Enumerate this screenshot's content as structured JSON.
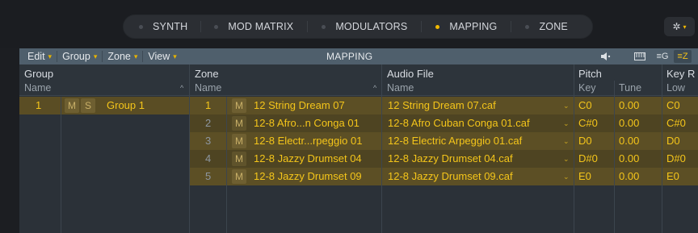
{
  "tabs": [
    {
      "label": "SYNTH",
      "active": false
    },
    {
      "label": "MOD MATRIX",
      "active": false
    },
    {
      "label": "MODULATORS",
      "active": false
    },
    {
      "label": "MAPPING",
      "active": true
    },
    {
      "label": "ZONE",
      "active": false
    }
  ],
  "settings_icon": "gear-icon",
  "toolbar": {
    "menus": [
      "Edit",
      "Group",
      "Zone",
      "View"
    ],
    "title": "MAPPING",
    "icons": [
      "speaker-icon",
      "keyboard-icon",
      "group-list-icon",
      "zone-list-icon"
    ]
  },
  "headers": {
    "group": "Group",
    "group_name": "Name",
    "zone": "Zone",
    "zone_name": "Name",
    "audio_file": "Audio File",
    "audio_name": "Name",
    "pitch": "Pitch",
    "key": "Key",
    "tune": "Tune",
    "key_range": "Key R",
    "low": "Low"
  },
  "group": {
    "index": "1",
    "m": "M",
    "s": "S",
    "name": "Group 1"
  },
  "zones": [
    {
      "num": "1",
      "m": "M",
      "name": "12 String Dream 07",
      "file": "12 String Dream 07.caf",
      "key": "C0",
      "tune": "0.00",
      "low": "C0"
    },
    {
      "num": "2",
      "m": "M",
      "name": "12-8 Afro...n Conga 01",
      "file": "12-8 Afro Cuban Conga 01.caf",
      "key": "C#0",
      "tune": "0.00",
      "low": "C#0"
    },
    {
      "num": "3",
      "m": "M",
      "name": "12-8 Electr...rpeggio 01",
      "file": "12-8 Electric Arpeggio 01.caf",
      "key": "D0",
      "tune": "0.00",
      "low": "D0"
    },
    {
      "num": "4",
      "m": "M",
      "name": "12-8 Jazzy Drumset 04",
      "file": "12-8 Jazzy Drumset 04.caf",
      "key": "D#0",
      "tune": "0.00",
      "low": "D#0"
    },
    {
      "num": "5",
      "m": "M",
      "name": "12-8 Jazzy Drumset 09",
      "file": "12-8 Jazzy Drumset 09.caf",
      "key": "E0",
      "tune": "0.00",
      "low": "E0"
    }
  ],
  "colors": {
    "accent": "#f4c51a",
    "selected_row": "#5e5126",
    "selected_row_alt": "#4e4522"
  }
}
